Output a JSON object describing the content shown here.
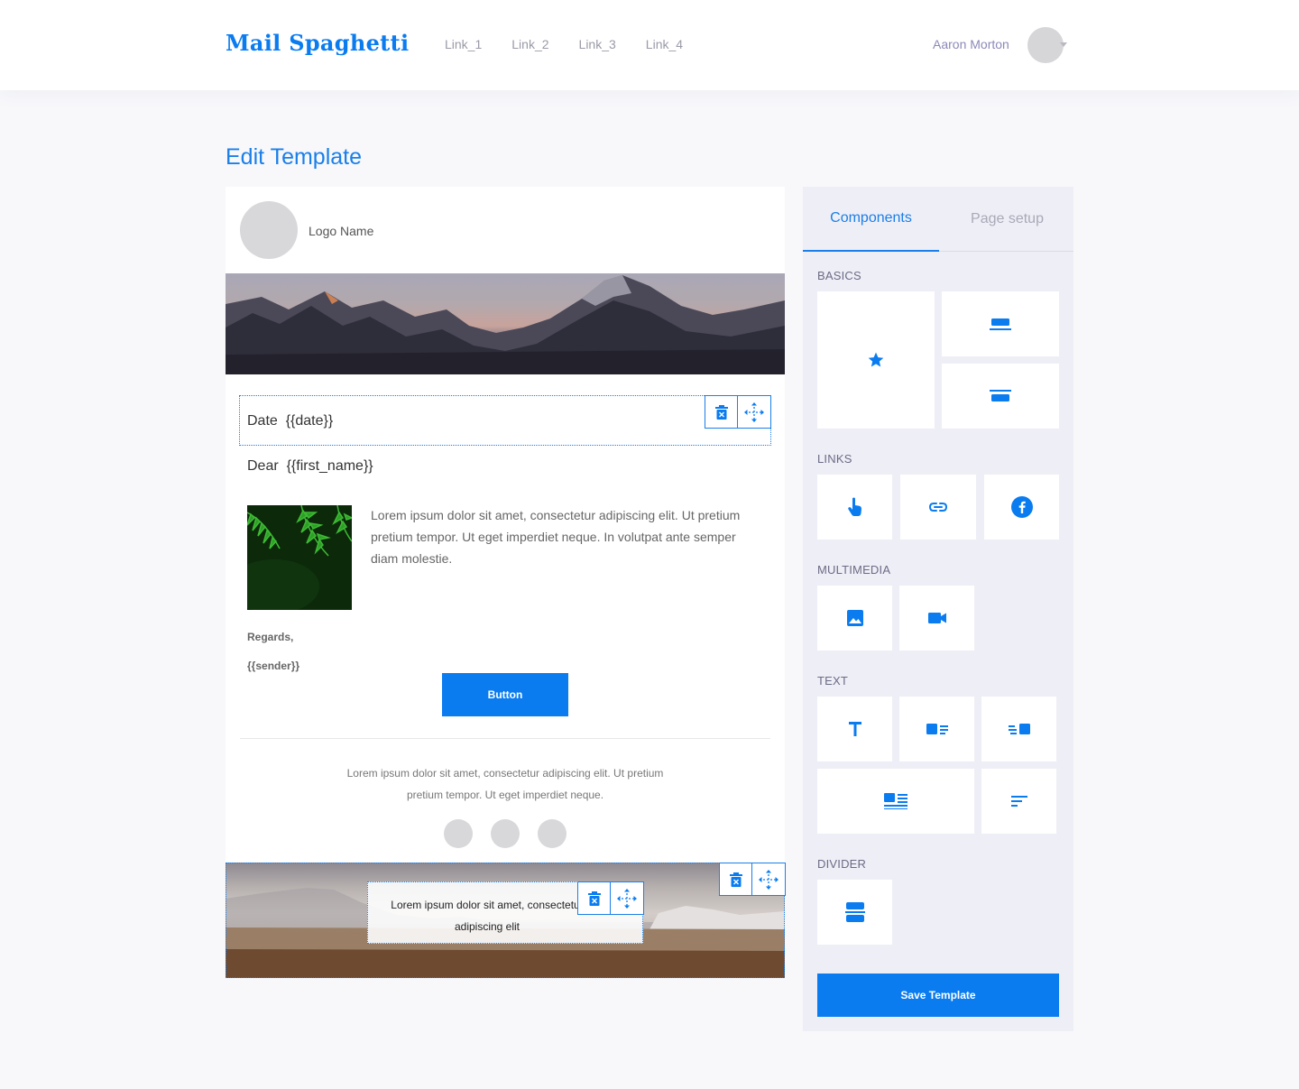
{
  "app": {
    "brand": "Mail Spaghetti"
  },
  "nav": {
    "links": [
      "Link_1",
      "Link_2",
      "Link_3",
      "Link_4"
    ]
  },
  "user": {
    "name": "Aaron Morton"
  },
  "page": {
    "title": "Edit Template"
  },
  "email": {
    "logo_name": "Logo Name",
    "date_line": "Date  {{date}}",
    "dear_line": "Dear  {{first_name}}",
    "body_text": "Lorem ipsum dolor sit amet, consectetur adipiscing elit. Ut pretium pretium tempor. Ut eget imperdiet neque. In volutpat ante semper diam molestie.",
    "regards": "Regards,",
    "sender": "{{sender}}",
    "button_label": "Button",
    "footer_text": "Lorem ipsum dolor sit amet, consectetur adipiscing elit. Ut pretium pretium tempor. Ut eget imperdiet neque.",
    "footer_card_text": "Lorem ipsum dolor sit amet, consectetur adipiscing elit"
  },
  "panel": {
    "tabs": [
      {
        "label": "Components",
        "active": true
      },
      {
        "label": "Page setup",
        "active": false
      }
    ],
    "sections": {
      "basics": "BASICS",
      "links": "LINKS",
      "multimedia": "MULTIMEDIA",
      "text": "TEXT",
      "divider": "DIVIDER"
    },
    "save_label": "Save Template"
  },
  "colors": {
    "accent": "#0a7cf0",
    "panel_bg": "#eeeef6",
    "page_bg": "#f8f8fb"
  },
  "icons": {
    "basics": [
      "star-icon",
      "header-block-icon",
      "footer-block-icon"
    ],
    "links": [
      "hand-pointer-icon",
      "link-icon",
      "facebook-icon"
    ],
    "multimedia": [
      "image-icon",
      "video-icon"
    ],
    "text": [
      "text-icon",
      "image-left-text-icon",
      "image-right-text-icon",
      "image-text-block-icon",
      "text-align-icon"
    ],
    "divider": [
      "divider-icon"
    ],
    "controls": [
      "trash-icon",
      "move-icon"
    ]
  }
}
